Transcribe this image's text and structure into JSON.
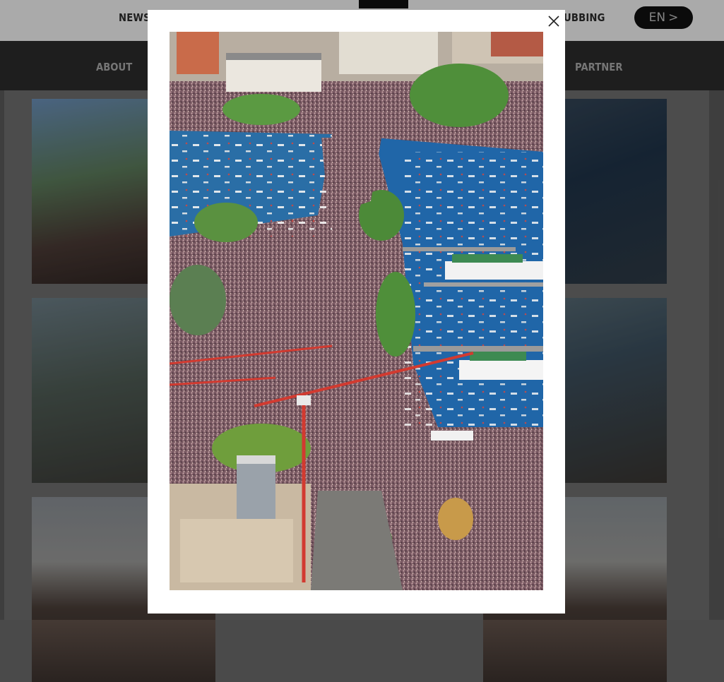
{
  "header": {
    "top_nav": [
      {
        "label": "NEWS"
      },
      {
        "label": "CLUBBING"
      }
    ],
    "language_button": {
      "label": "EN",
      "chevron": ">"
    }
  },
  "main_nav": [
    {
      "label": "ABOUT"
    },
    {
      "label": "PARTNER"
    }
  ],
  "lightbox": {
    "close_icon": "close-icon",
    "image_alt": "Aerial photo of a massive street parade crowd filling a bridge and lakeside streets, with boats on the water, historic buildings and a red construction crane"
  },
  "colors": {
    "topbar_bg": "#f4f4f4",
    "mainbar_bg": "#2c2c2c",
    "accent_dark": "#111111",
    "modal_bg": "#ffffff"
  }
}
